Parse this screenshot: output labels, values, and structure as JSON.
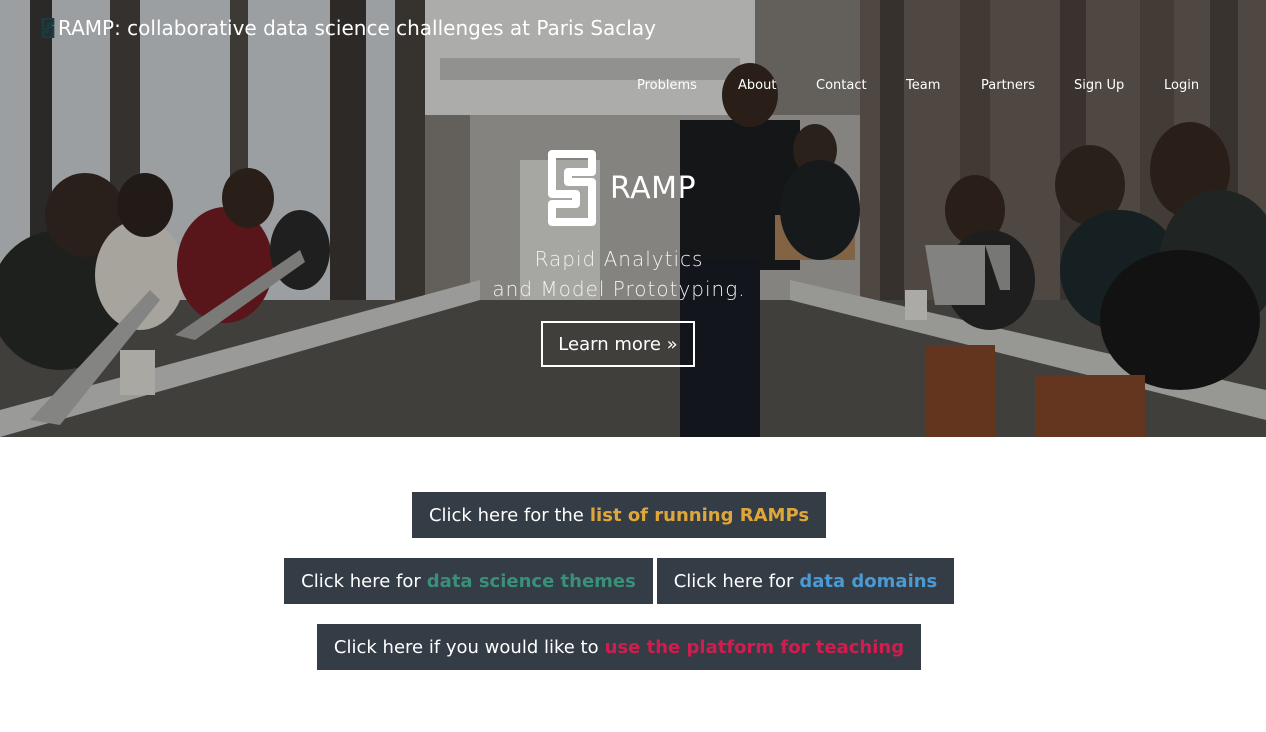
{
  "brand": {
    "icon": "ramp-logo-icon",
    "title": "RAMP: collaborative data science challenges at Paris Saclay"
  },
  "nav": {
    "items": [
      {
        "label": "Problems"
      },
      {
        "label": "About"
      },
      {
        "label": "Contact"
      },
      {
        "label": "Team"
      },
      {
        "label": "Partners"
      },
      {
        "label": "Sign Up"
      },
      {
        "label": "Login"
      }
    ]
  },
  "hero": {
    "logo_text": "RAMP",
    "tagline_line1": "Rapid Analytics",
    "tagline_line2": "and Model Prototyping.",
    "learn_more": "Learn more »"
  },
  "ctas": {
    "running": {
      "prefix": "Click here for the",
      "highlight": "list of running RAMPs",
      "color": "#e0a63a"
    },
    "themes": {
      "prefix": "Click here for",
      "highlight": "data science themes",
      "color": "#3a8f78"
    },
    "domains": {
      "prefix": "Click here for",
      "highlight": "data domains",
      "color": "#4a9ad4"
    },
    "teaching": {
      "prefix": "Click here if you would like to",
      "highlight": "use the platform for teaching",
      "color": "#d31c4e"
    }
  }
}
